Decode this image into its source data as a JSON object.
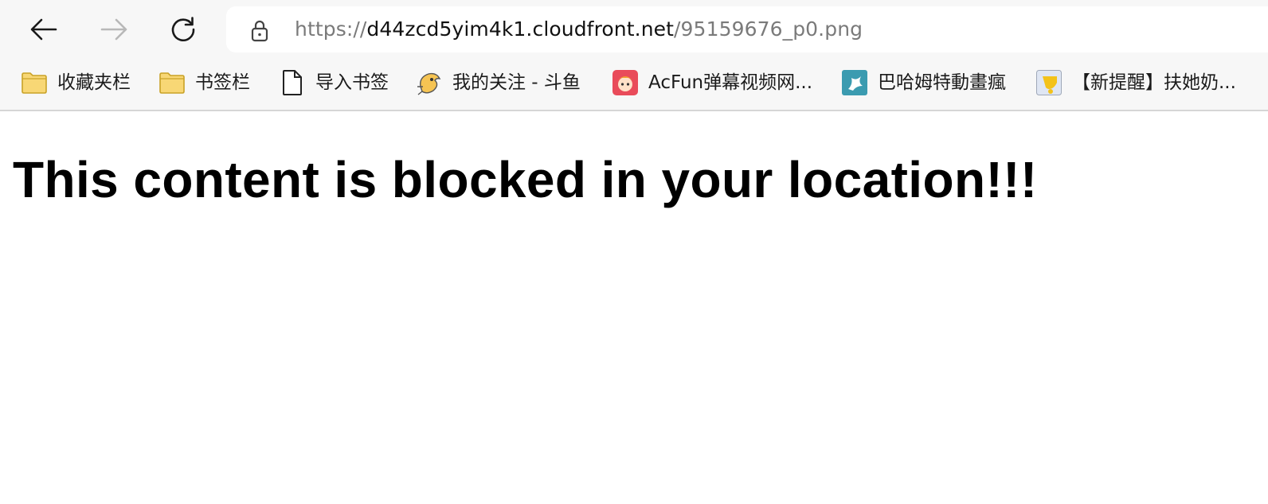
{
  "browser": {
    "nav": {
      "back_icon": "arrow-left-icon",
      "forward_icon": "arrow-right-icon",
      "reload_icon": "reload-icon"
    },
    "address_bar": {
      "lock_icon": "lock-icon",
      "url_scheme": "https://",
      "url_host": "d44zcd5yim4k1.cloudfront.net",
      "url_path": "/95159676_p0.png"
    },
    "bookmarks": [
      {
        "label": "收藏夹栏",
        "icon": "folder-icon"
      },
      {
        "label": "书签栏",
        "icon": "folder-icon"
      },
      {
        "label": "导入书签",
        "icon": "page-icon"
      },
      {
        "label": "我的关注 - 斗鱼",
        "icon": "douyu-fish-icon"
      },
      {
        "label": "AcFun弹幕视频网...",
        "icon": "acfun-icon"
      },
      {
        "label": "巴哈姆特動畫瘋",
        "icon": "bahamut-icon"
      },
      {
        "label": "【新提醒】扶她奶...",
        "icon": "site-favicon-icon"
      }
    ]
  },
  "page": {
    "message": "This content is blocked in your location!!!"
  },
  "colors": {
    "chrome_bg": "#f7f7f7",
    "folder_fill": "#f8d775",
    "folder_stroke": "#c9a227",
    "acfun_red": "#e94b5a",
    "bahamut_teal": "#3b9bb0"
  }
}
